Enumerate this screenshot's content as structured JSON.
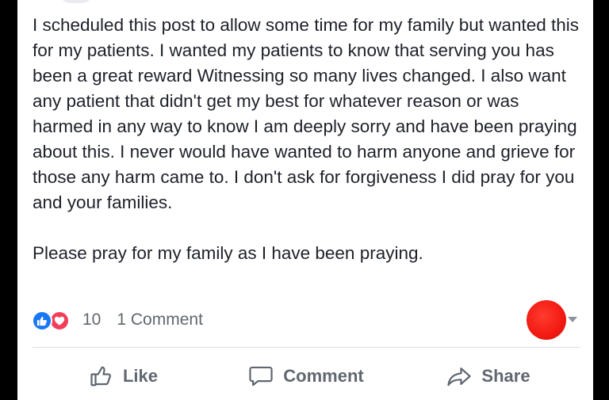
{
  "post": {
    "paragraphs": [
      "I scheduled this post to allow some time for my family but wanted this for my patients. I wanted my patients to know that serving you has been a great reward Witnessing so many lives changed. I also want any patient that didn't get my best for whatever reason or was harmed in any way to know I am deeply sorry and have been praying about this. I never would have wanted to harm anyone and grieve for those any harm came to. I don't ask for forgiveness I did pray for you and your families.",
      "Please pray for my family as I have been praying."
    ]
  },
  "reactions": {
    "icons": [
      "like-reaction-icon",
      "love-reaction-icon"
    ],
    "count": "10",
    "comments_label": "1 Comment"
  },
  "actions": {
    "like_label": "Like",
    "comment_label": "Comment",
    "share_label": "Share"
  },
  "colors": {
    "like_blue": "#1877f2",
    "love_red": "#f33e58",
    "text": "#1d2129",
    "secondary_text": "#606770",
    "red_dot": "#f21a12"
  }
}
